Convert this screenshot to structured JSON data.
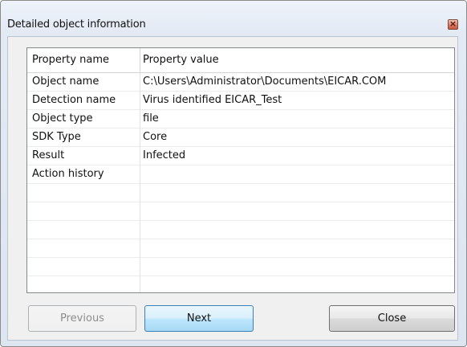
{
  "window": {
    "title": "Detailed object information",
    "close_glyph": "×"
  },
  "table": {
    "columns": [
      "Property name",
      "Property value"
    ],
    "rows": [
      {
        "name": "Object name",
        "value": "C:\\Users\\Administrator\\Documents\\EICAR.COM"
      },
      {
        "name": "Detection name",
        "value": "Virus identified EICAR_Test"
      },
      {
        "name": "Object type",
        "value": "file"
      },
      {
        "name": "SDK Type",
        "value": "Core"
      },
      {
        "name": "Result",
        "value": "Infected"
      },
      {
        "name": "Action history",
        "value": ""
      },
      {
        "name": "",
        "value": ""
      },
      {
        "name": "",
        "value": ""
      },
      {
        "name": "",
        "value": ""
      },
      {
        "name": "",
        "value": ""
      },
      {
        "name": "",
        "value": ""
      },
      {
        "name": "",
        "value": ""
      }
    ]
  },
  "buttons": {
    "previous": "Previous",
    "next": "Next",
    "close": "Close"
  }
}
